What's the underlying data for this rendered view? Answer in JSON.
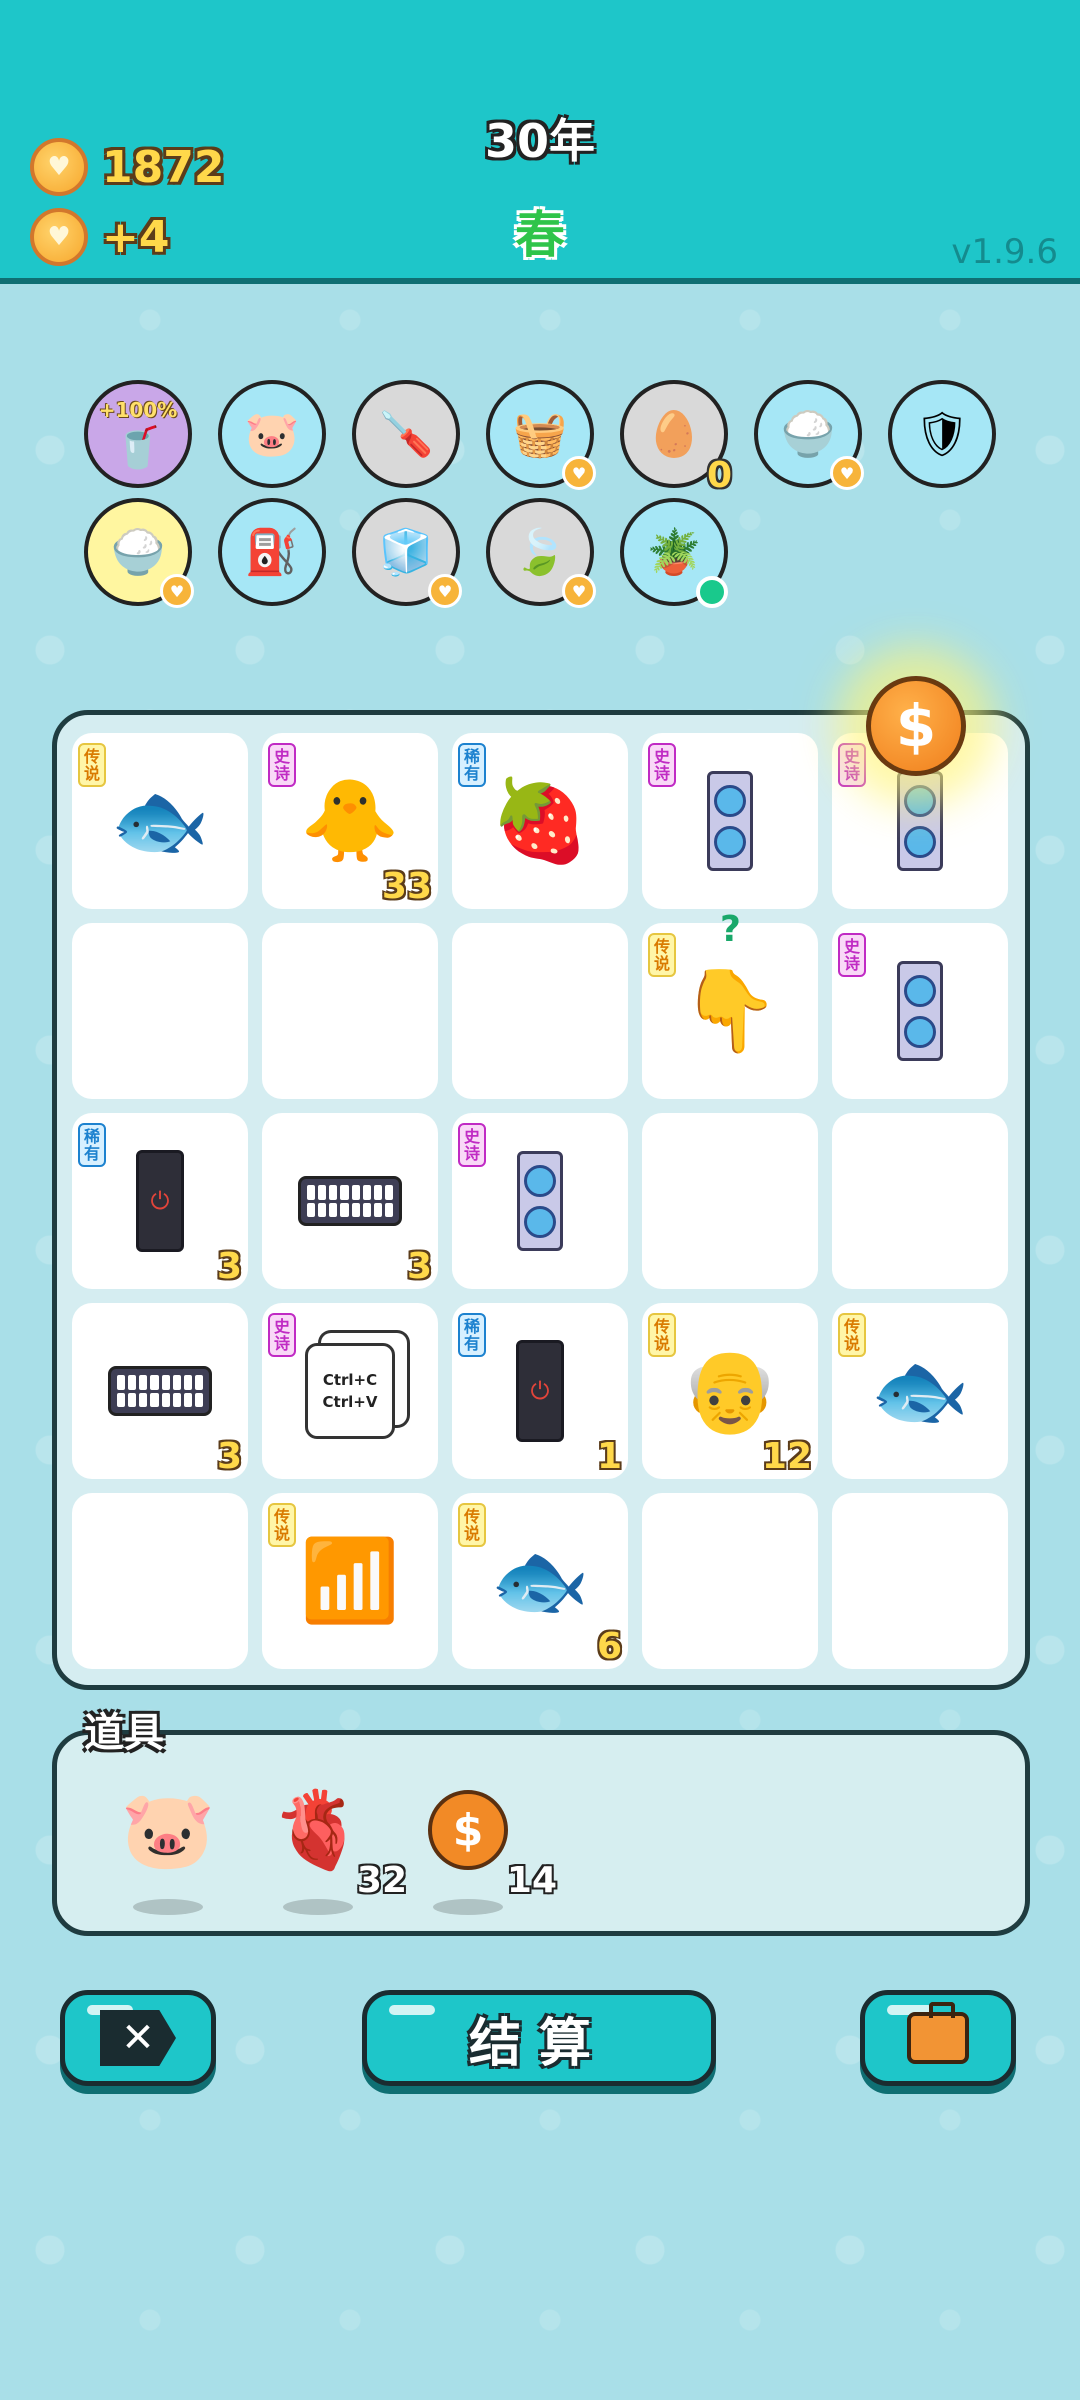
{
  "header": {
    "coins": "1872",
    "income": "+4",
    "year": "30年",
    "season": "春",
    "version": "v1.9.6"
  },
  "buffs": [
    {
      "name": "milk-tea-icon",
      "label": "+100%",
      "bg": "#c9a7e8"
    },
    {
      "name": "piggy-bank-icon",
      "bg": "#a6e7f6"
    },
    {
      "name": "screwdriver-icon",
      "bg": "#d9d9d9"
    },
    {
      "name": "fruit-basket-icon",
      "bg": "#a6e7f6"
    },
    {
      "name": "egg-tray-icon",
      "count": "0",
      "bg": "#d9d9d9"
    },
    {
      "name": "rice-bowl-icon",
      "bg": "#a6e7f6"
    },
    {
      "name": "shield-icon",
      "bg": "#a6e7f6"
    },
    {
      "name": "rice-bowl-icon",
      "bg": "#fff6a0"
    },
    {
      "name": "pump-icon",
      "bg": "#a6e7f6"
    },
    {
      "name": "sugar-cubes-icon",
      "bg": "#d9d9d9"
    },
    {
      "name": "leaf-icon",
      "bg": "#d9d9d9"
    },
    {
      "name": "flower-pot-icon",
      "bg": "#a6e7f6"
    }
  ],
  "board": {
    "tags": {
      "legend": "传说",
      "epic": "史诗",
      "rare": "稀有"
    },
    "counts": {
      "r0c1": "33",
      "r2c0": "3",
      "r2c1": "3",
      "r3c0": "3",
      "r3c2": "1",
      "r3c3": "12",
      "r4c2": "6"
    },
    "ctrl_lines": [
      "Ctrl+C",
      "Ctrl+V"
    ],
    "question": "?"
  },
  "props": {
    "title": "道具",
    "liver_count": "32",
    "coin_count": "14"
  },
  "buttons": {
    "settle": "结算"
  },
  "colors": {
    "header": "#1ec6c9",
    "background": "#a9dfe8",
    "accent_yellow": "#ffd84a"
  }
}
